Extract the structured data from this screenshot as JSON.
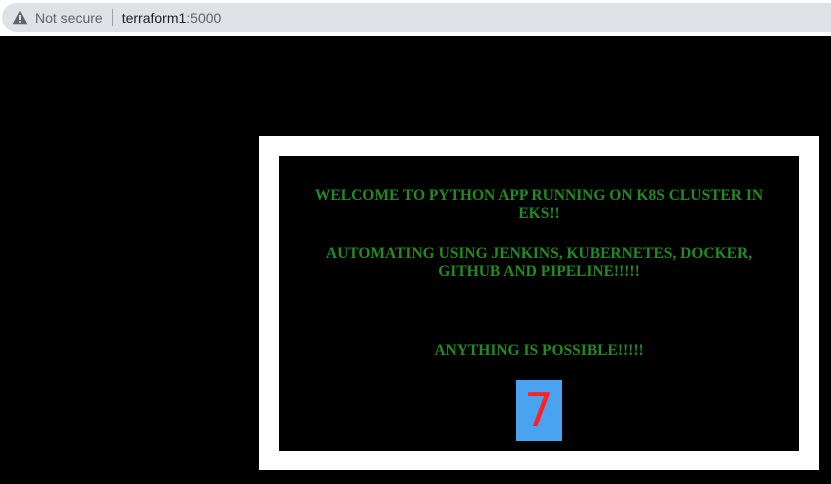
{
  "browser": {
    "security_label": "Not secure",
    "url_host": "terraform1",
    "url_port": ":5000",
    "icons": {
      "security": "warning-triangle-icon"
    }
  },
  "page": {
    "welcome_text": "WELCOME TO PYTHON APP RUNNING ON K8S CLUSTER IN EKS!!",
    "automating_text": "AUTOMATING USING JENKINS, KUBERNETES, DOCKER, GITHUB AND PIPELINE!!!!!",
    "possible_text": "ANYTHING IS POSSIBLE!!!!!",
    "counter_value": "7"
  },
  "colors": {
    "page_background": "#000000",
    "frame": "#ffffff",
    "message_text": "#228b22",
    "counter_background": "#4aa3f0",
    "counter_text": "#ff2020"
  }
}
